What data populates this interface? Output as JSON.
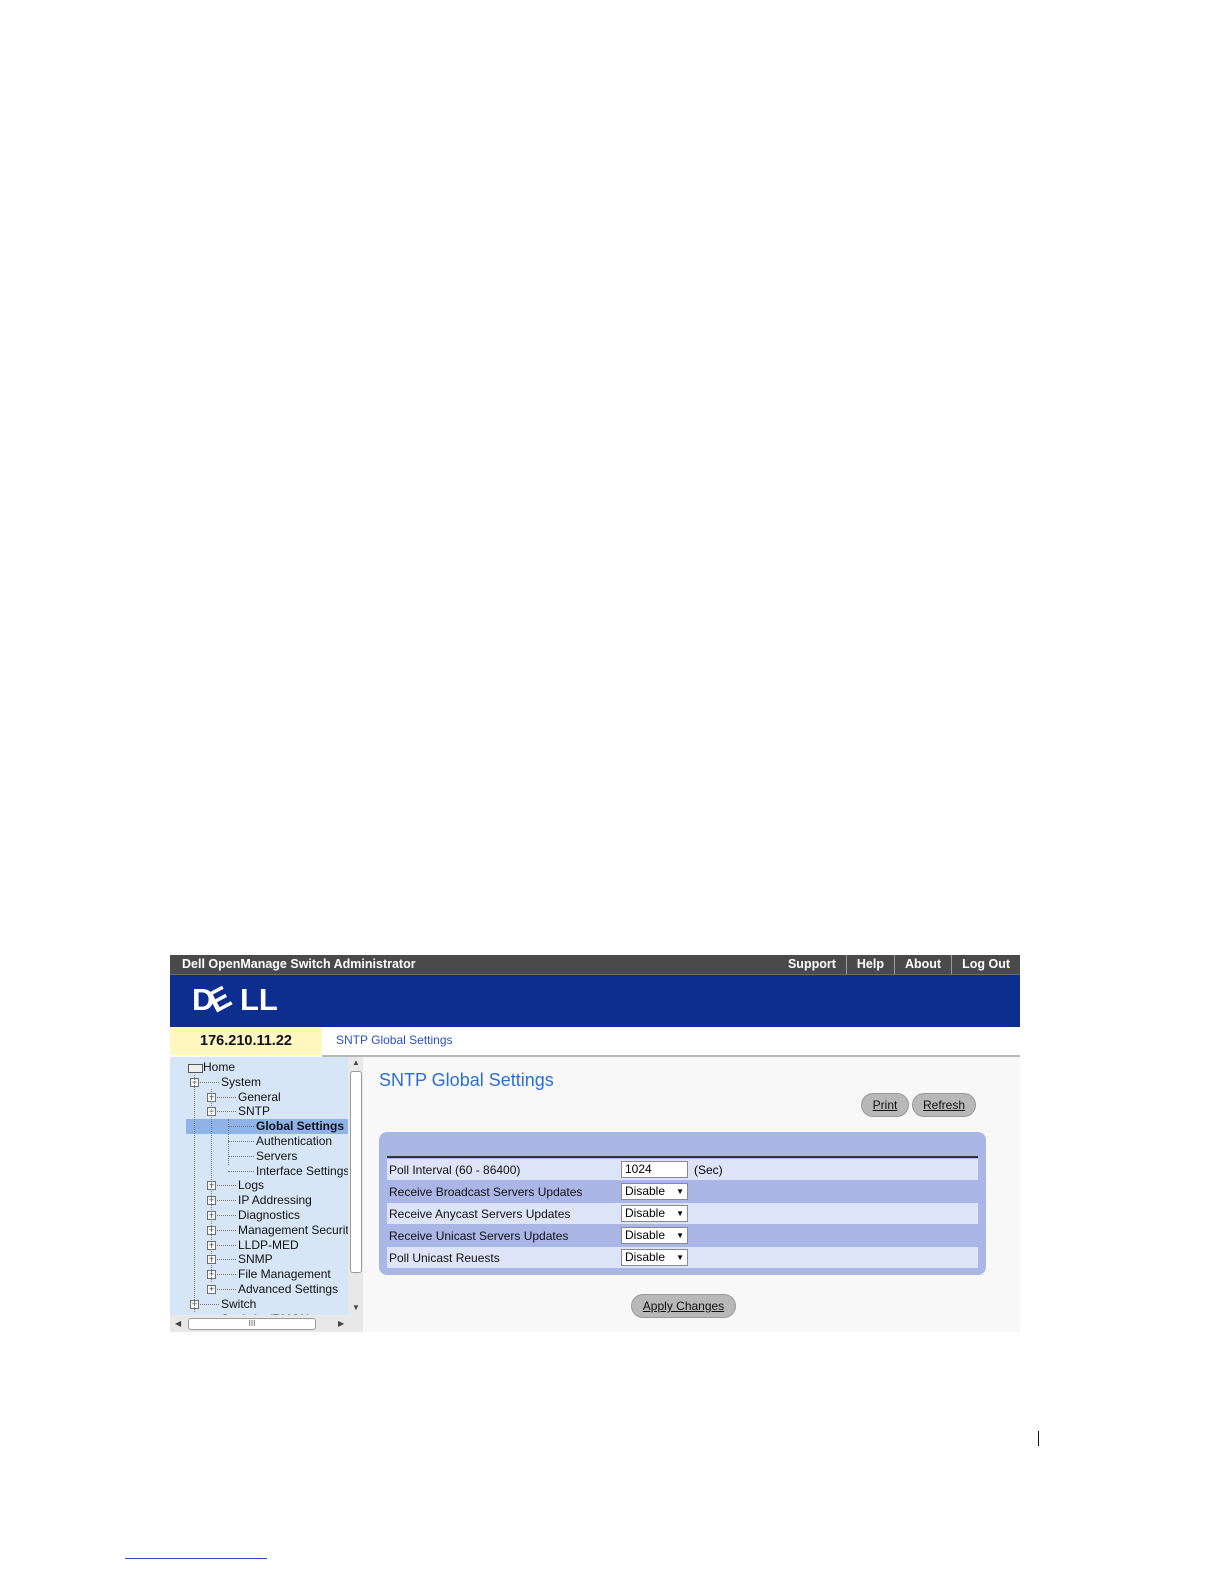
{
  "topbar": {
    "title": "Dell OpenManage Switch Administrator",
    "links": [
      "Support",
      "Help",
      "About",
      "Log Out"
    ]
  },
  "banner": {
    "logo": "DELL"
  },
  "address": {
    "ip": "176.210.11.22",
    "breadcrumb": "SNTP Global Settings"
  },
  "tree": {
    "items": [
      {
        "label": "Home",
        "expander": "",
        "icon": "home-icon"
      },
      {
        "label": "System",
        "expander": "minus"
      },
      {
        "label": "General",
        "expander": "plus"
      },
      {
        "label": "SNTP",
        "expander": "minus"
      },
      {
        "label": "Global Settings",
        "expander": "",
        "selected": true
      },
      {
        "label": "Authentication",
        "expander": ""
      },
      {
        "label": "Servers",
        "expander": ""
      },
      {
        "label": "Interface Settings",
        "expander": ""
      },
      {
        "label": "Logs",
        "expander": "plus"
      },
      {
        "label": "IP Addressing",
        "expander": "plus"
      },
      {
        "label": "Diagnostics",
        "expander": "plus"
      },
      {
        "label": "Management Securit",
        "expander": "plus"
      },
      {
        "label": "LLDP-MED",
        "expander": "plus"
      },
      {
        "label": "SNMP",
        "expander": "plus"
      },
      {
        "label": "File Management",
        "expander": "plus"
      },
      {
        "label": "Advanced Settings",
        "expander": "plus"
      },
      {
        "label": "Switch",
        "expander": "plus"
      },
      {
        "label": "Statistics/RMON",
        "expander": "plus"
      }
    ],
    "hscroll_grip": "III"
  },
  "main": {
    "title": "SNTP Global Settings",
    "print_label": "Print",
    "refresh_label": "Refresh",
    "apply_label": "Apply Changes",
    "fields": [
      {
        "label": "Poll Interval (60 - 86400)",
        "type": "input",
        "value": "1024",
        "unit": "(Sec)"
      },
      {
        "label": "Receive Broadcast Servers Updates",
        "type": "select",
        "value": "Disable"
      },
      {
        "label": "Receive Anycast Servers Updates",
        "type": "select",
        "value": "Disable"
      },
      {
        "label": "Receive Unicast Servers Updates",
        "type": "select",
        "value": "Disable"
      },
      {
        "label": "Poll Unicast Reuests",
        "type": "select",
        "value": "Disable"
      }
    ]
  },
  "colors": {
    "banner": "#0d2e8f",
    "topbar": "#4a4a4a",
    "sidebar": "#d7e6f6",
    "panel": "#a9b6e6",
    "title": "#2a6fd6"
  }
}
